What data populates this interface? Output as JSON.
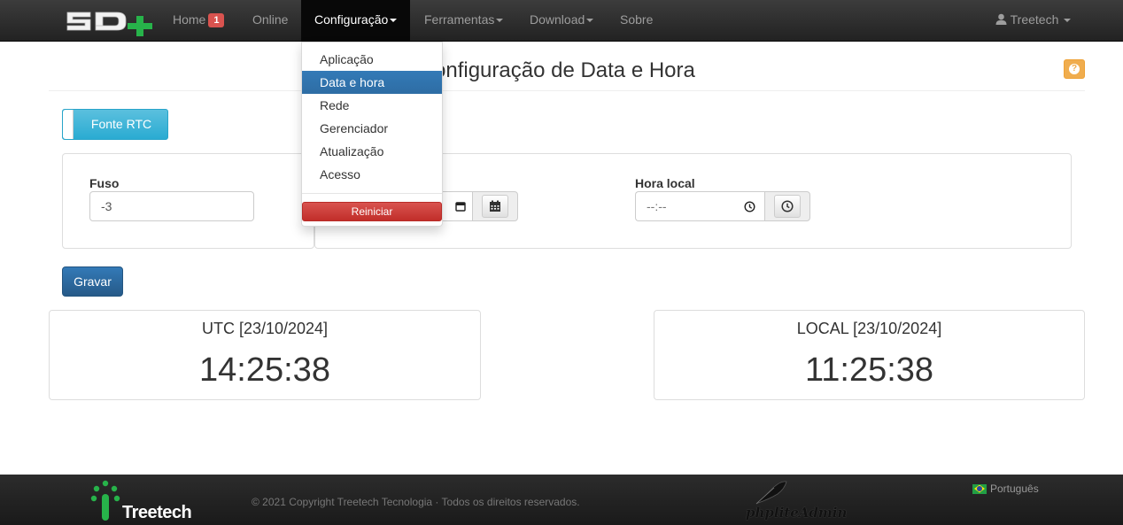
{
  "navbar": {
    "brand": "SD+",
    "home": {
      "label": "Home",
      "badge": "1"
    },
    "items": [
      "Online",
      "Configuração",
      "Ferramentas",
      "Download",
      "Sobre"
    ],
    "user": "Treetech"
  },
  "dropdown": {
    "items": [
      "Aplicação",
      "Data e hora",
      "Rede",
      "Gerenciador",
      "Atualização",
      "Acesso"
    ],
    "active": "Data e hora",
    "restart_label": "Reiniciar"
  },
  "page": {
    "title": "Configuração de Data e Hora",
    "title_visible": "onfiguração de Data e Hora"
  },
  "toggle": {
    "label": "Fonte RTC"
  },
  "form": {
    "timezone_label": "Fuso",
    "timezone_value": "-3",
    "local_time_label": "Hora local",
    "local_time_placeholder": "--:--"
  },
  "save_label": "Gravar",
  "clocks": {
    "utc": {
      "header": "UTC [23/10/2024]",
      "time": "14:25:38"
    },
    "local": {
      "header": "LOCAL [23/10/2024]",
      "time": "11:25:38"
    }
  },
  "footer": {
    "company": "Treetech",
    "copyright": "© 2021 Copyright Treetech Tecnologia · Todos os direitos reservados.",
    "admin_logo": "phpliteAdmin",
    "language": "Português"
  },
  "colors": {
    "primary": "#337ab7",
    "info": "#5bc0de",
    "danger": "#d9534f",
    "warning": "#f0ad4e",
    "navbar": "#222222",
    "brand_green": "#27b34a"
  }
}
